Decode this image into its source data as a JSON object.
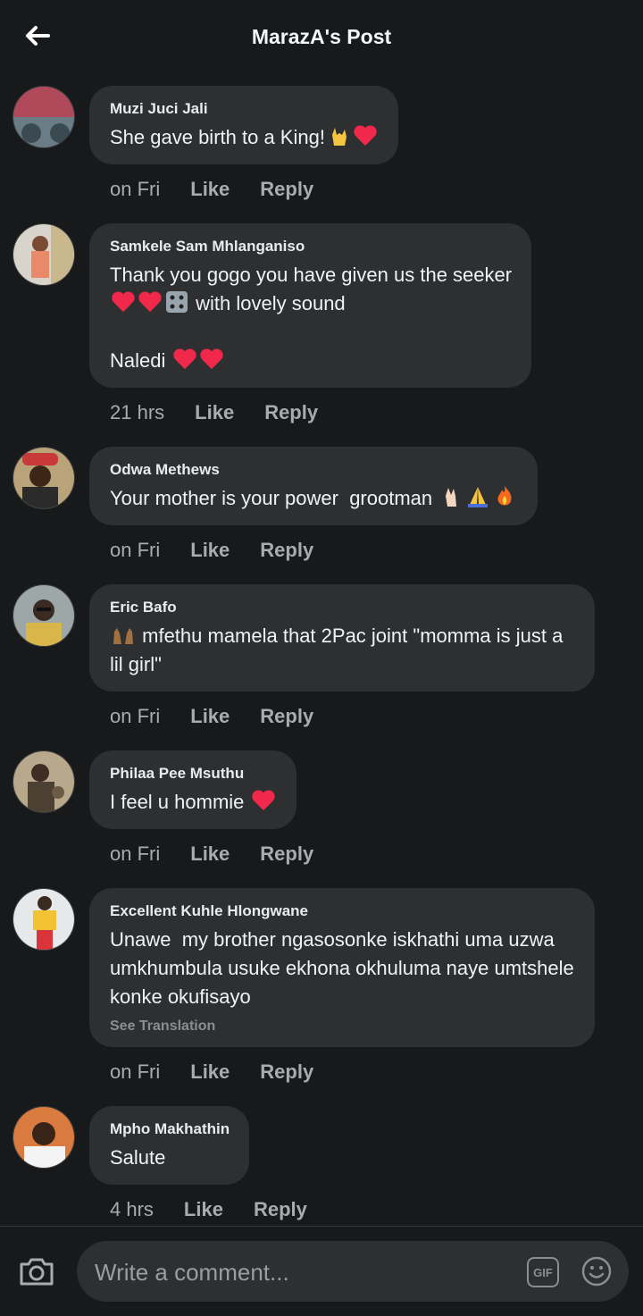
{
  "header": {
    "title": "MarazA's Post",
    "back_icon": "arrow-left-icon"
  },
  "comments": [
    {
      "author": "Muzi Juci Jali",
      "text": "She gave birth to a King!",
      "emojis_after": [
        "love-you-gesture",
        "red-heart"
      ],
      "time": "on Fri",
      "like": "Like",
      "reply": "Reply"
    },
    {
      "author": "Samkele Sam Mhlanganiso",
      "text_line1": "Thank you gogo you have given us the seeker",
      "line2_text": "with lovely sound",
      "line2_emojis_before": [
        "red-heart",
        "red-heart",
        "dice"
      ],
      "text_line3": "Naledi",
      "line3_emojis_after": [
        "red-heart",
        "red-heart"
      ],
      "time": "21 hrs",
      "like": "Like",
      "reply": "Reply"
    },
    {
      "author": "Odwa Methews",
      "text": "Your mother is your power  grootman",
      "emojis_after": [
        "crossed-fingers",
        "folded-hands",
        "fire"
      ],
      "time": "on Fri",
      "like": "Like",
      "reply": "Reply"
    },
    {
      "author": "Eric Bafo",
      "text": "mfethu mamela that 2Pac joint \"momma is just a lil girl\"",
      "emojis_before": [
        "raising-hands"
      ],
      "time": "on Fri",
      "like": "Like",
      "reply": "Reply"
    },
    {
      "author": "Philaa Pee Msuthu",
      "text": "I feel u hommie",
      "emojis_after": [
        "red-heart"
      ],
      "time": "on Fri",
      "like": "Like",
      "reply": "Reply"
    },
    {
      "author": "Excellent Kuhle Hlongwane",
      "text": "Unawe  my brother ngasosonke iskhathi uma uzwa umkhumbula usuke ekhona okhuluma naye umtshele konke okufisayo",
      "see_translation": "See Translation",
      "time": "on Fri",
      "like": "Like",
      "reply": "Reply"
    },
    {
      "author": "Mpho Makhathin",
      "text": "Salute",
      "time": "4 hrs",
      "like": "Like",
      "reply": "Reply"
    }
  ],
  "composer": {
    "placeholder": "Write a comment...",
    "gif_label": "GIF",
    "camera_icon": "camera-icon",
    "emoji_icon": "smiley-icon"
  },
  "colors": {
    "background": "#18191b",
    "bubble": "#2e2f31",
    "heart": "#f02849",
    "muted_text": "#a8abaf"
  }
}
